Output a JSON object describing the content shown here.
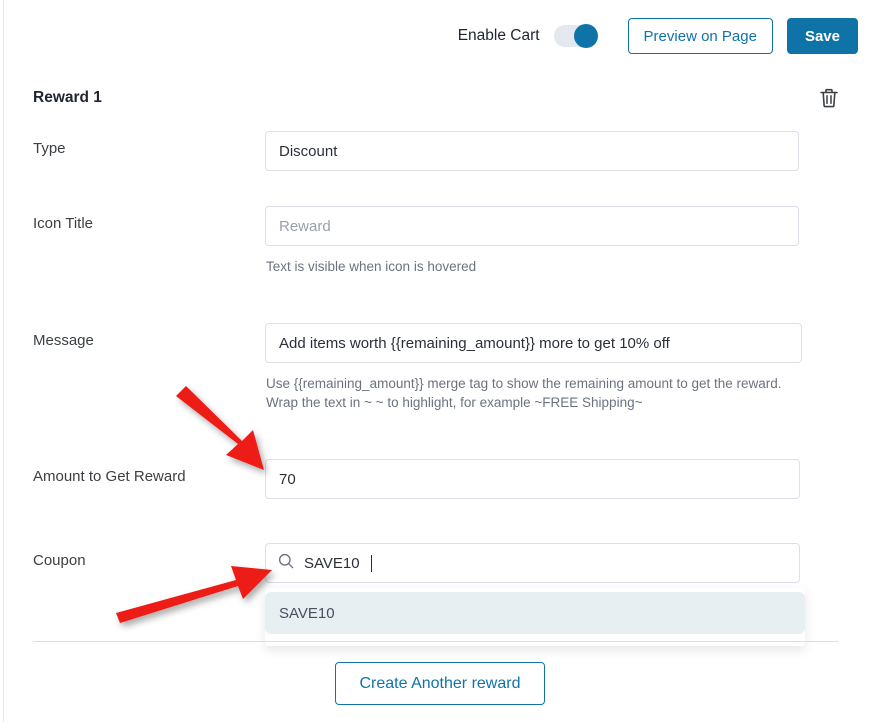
{
  "topbar": {
    "enable_cart_label": "Enable Cart",
    "toggle_state": "on",
    "preview_label": "Preview on Page",
    "save_label": "Save"
  },
  "reward": {
    "title": "Reward 1",
    "delete_icon": "trash-icon"
  },
  "fields": {
    "type": {
      "label": "Type",
      "value": "Discount"
    },
    "icon_title": {
      "label": "Icon Title",
      "value": "",
      "placeholder": "Reward",
      "hint": "Text is visible when icon is hovered"
    },
    "message": {
      "label": "Message",
      "value": "Add items worth {{remaining_amount}} more to get 10% off",
      "hint_line1": "Use {{remaining_amount}} merge tag to show the remaining amount to get the reward.",
      "hint_line2": "Wrap the text in ~ ~ to highlight, for example ~FREE Shipping~"
    },
    "amount": {
      "label": "Amount to Get Reward",
      "value": "70"
    },
    "coupon": {
      "label": "Coupon",
      "value": "SAVE10",
      "search_icon": "search-icon",
      "suggestions": [
        "SAVE10"
      ]
    }
  },
  "footer": {
    "create_label": "Create Another reward"
  },
  "colors": {
    "accent": "#1073a8",
    "arrow": "#ee1c16",
    "field_border": "#dcdfe8",
    "suggestion_bg": "#e8eff3"
  }
}
